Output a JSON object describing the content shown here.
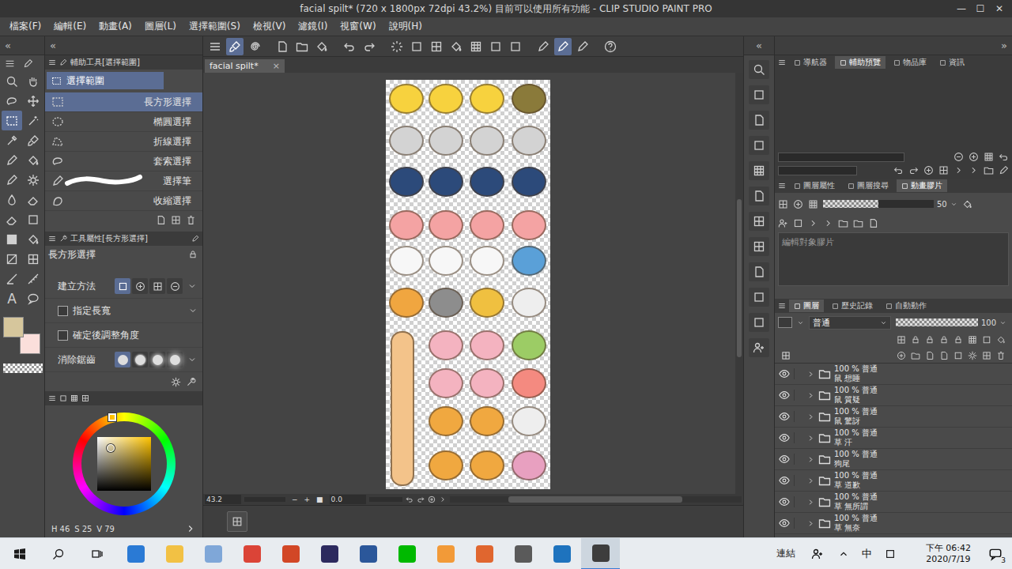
{
  "window": {
    "title": "facial spilt* (720 x 1800px 72dpi 43.2%)  目前可以使用所有功能 - CLIP STUDIO PAINT PRO",
    "controls": [
      "—",
      "☐",
      "✕"
    ]
  },
  "menu": [
    "檔案(F)",
    "編輯(E)",
    "動畫(A)",
    "圖層(L)",
    "選擇範圍(S)",
    "檢視(V)",
    "濾鏡(I)",
    "視窗(W)",
    "說明(H)"
  ],
  "arrows": {
    "tools": "«",
    "subtool": "«",
    "icons": "«",
    "panel": "»"
  },
  "tools": [
    {
      "selected": false
    },
    {
      "selected": false
    },
    {
      "selected": false
    },
    {
      "selected": false
    },
    {
      "selected": true
    },
    {
      "selected": false
    },
    {
      "selected": false
    },
    {
      "selected": false
    },
    {
      "selected": false
    },
    {
      "selected": false
    },
    {
      "selected": false
    },
    {
      "selected": false
    },
    {
      "selected": false
    },
    {
      "selected": false
    },
    {
      "selected": false
    },
    {
      "selected": false
    },
    {
      "selected": false
    },
    {
      "selected": false
    },
    {
      "selected": false
    },
    {
      "selected": false
    },
    {
      "selected": false
    },
    {
      "selected": false
    },
    {
      "selected": false,
      "glyph": "A"
    },
    {
      "selected": false
    }
  ],
  "toolbar": [
    {
      "selected": false
    },
    {
      "selected": true
    },
    {
      "selected": false
    },
    {
      "selected": false
    },
    {
      "selected": false
    },
    {
      "selected": false
    },
    {
      "selected": false
    },
    {
      "selected": false
    },
    {
      "selected": false
    },
    {
      "selected": false
    },
    {
      "selected": false
    },
    {
      "selected": false
    },
    {
      "selected": false
    },
    {
      "selected": false
    },
    {
      "selected": false
    },
    {
      "selected": false
    },
    {
      "selected": true
    },
    {
      "selected": false
    },
    {
      "selected": false
    }
  ],
  "subtool": {
    "title": "輔助工具[選擇範圍]",
    "group": {
      "label": "選擇範圍",
      "selected": true
    },
    "items": [
      {
        "label": "長方形選擇",
        "selected": true
      },
      {
        "label": "橢圓選擇",
        "selected": false
      },
      {
        "label": "折線選擇",
        "selected": false
      },
      {
        "label": "套索選擇",
        "selected": false
      },
      {
        "label": "選擇筆",
        "selected": false
      },
      {
        "label": "收縮選擇",
        "selected": false
      }
    ]
  },
  "tool_property": {
    "title": "工具屬性[長方形選擇]",
    "tool": "長方形選擇",
    "create_method": {
      "label": "建立方法",
      "options": [
        {
          "selected": true
        },
        {
          "selected": false
        },
        {
          "selected": false
        },
        {
          "selected": false
        }
      ]
    },
    "fixed_ratio": {
      "label": "指定長寬",
      "checked": false
    },
    "adjust_angle": {
      "label": "確定後調整角度",
      "checked": false
    },
    "antialias": {
      "label": "消除鋸齒",
      "options": [
        {
          "selected": true
        },
        {
          "selected": false
        },
        {
          "selected": false
        },
        {
          "selected": false
        }
      ]
    }
  },
  "color": {
    "main": "#d6c69c",
    "sub": "#fbdfdb",
    "hue_level": 0.128,
    "hsv": [
      {
        "label": "H",
        "value": "46"
      },
      {
        "label": "S",
        "value": "25"
      },
      {
        "label": "V",
        "value": "79"
      }
    ]
  },
  "document": {
    "tab": "facial spilt*",
    "close": "×",
    "zoom": "43.2",
    "angle": "0.0",
    "zoom_buttons": [
      "−",
      "+",
      "■"
    ]
  },
  "right_panel": {
    "top_tabs": [
      {
        "label": "導航器",
        "selected": false
      },
      {
        "label": "輔助預覽",
        "selected": true
      },
      {
        "label": "物品庫",
        "selected": false
      },
      {
        "label": "資訊",
        "selected": false
      }
    ],
    "mid_tabs": [
      {
        "label": "圖層屬性",
        "selected": false
      },
      {
        "label": "圖層搜尋",
        "selected": false
      },
      {
        "label": "動畫膠片",
        "selected": true
      }
    ],
    "onion": {
      "value": "50",
      "level": 0.5
    },
    "film_hint": "編輯對象膠片"
  },
  "layers": {
    "tabs": [
      {
        "label": "圖層",
        "selected": true
      },
      {
        "label": "歷史記錄",
        "selected": false
      },
      {
        "label": "自動動作",
        "selected": false
      }
    ],
    "blend": "普通",
    "opacity": "100",
    "opacity_level": 1,
    "items": [
      {
        "mode": "100 % 普通",
        "name": "鼠 想睡",
        "visible": true,
        "expanded": false
      },
      {
        "mode": "100 % 普通",
        "name": "鼠 質疑",
        "visible": true,
        "expanded": false
      },
      {
        "mode": "100 % 普通",
        "name": "鼠 驚訝",
        "visible": true,
        "expanded": false
      },
      {
        "mode": "100 % 普通",
        "name": "草 汗",
        "visible": true,
        "expanded": false
      },
      {
        "mode": "100 % 普通",
        "name": "狗尾",
        "visible": true,
        "expanded": false
      },
      {
        "mode": "100 % 普通",
        "name": "草 道歉",
        "visible": true,
        "expanded": false
      },
      {
        "mode": "100 % 普通",
        "name": "草 無所謂",
        "visible": true,
        "expanded": false
      },
      {
        "mode": "100 % 普通",
        "name": "草 無奈",
        "visible": true,
        "expanded": false
      }
    ]
  },
  "taskbar": {
    "apps": [
      {
        "kind": "start",
        "color": "#1a1a1a",
        "selected": false
      },
      {
        "kind": "search",
        "color": "#1a1a1a",
        "selected": false
      },
      {
        "kind": "taskview",
        "color": "#1a1a1a",
        "selected": false
      },
      {
        "kind": "app",
        "color": "#2a7ad5",
        "selected": false
      },
      {
        "kind": "app",
        "color": "#f2c144",
        "selected": false
      },
      {
        "kind": "app",
        "color": "#7fa7d8",
        "selected": false
      },
      {
        "kind": "app",
        "color": "#db4437",
        "selected": false
      },
      {
        "kind": "app",
        "color": "#d24726",
        "selected": false
      },
      {
        "kind": "app",
        "color": "#2c2a5e",
        "selected": false
      },
      {
        "kind": "app",
        "color": "#2b579a",
        "selected": false
      },
      {
        "kind": "app",
        "color": "#00b900",
        "selected": false
      },
      {
        "kind": "app",
        "color": "#f29a38",
        "selected": false
      },
      {
        "kind": "app",
        "color": "#e0662f",
        "selected": false
      },
      {
        "kind": "app",
        "color": "#5a5a5a",
        "selected": false
      },
      {
        "kind": "app",
        "color": "#1e73be",
        "selected": false
      },
      {
        "kind": "app",
        "color": "#3d3d3d",
        "selected": true
      }
    ],
    "tray": [
      "連結",
      "中"
    ],
    "time": "下午 06:42",
    "date": "2020/7/19",
    "notifications": "3"
  }
}
